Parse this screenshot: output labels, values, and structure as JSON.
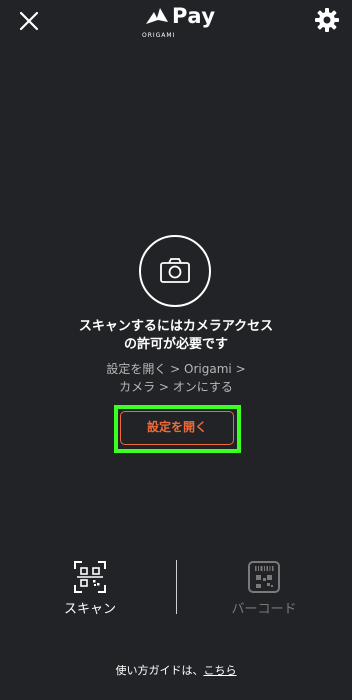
{
  "header": {
    "logo_text": "Pay",
    "logo_sub": "ORIGAMI"
  },
  "permission": {
    "title_line1": "スキャンするにはカメラアクセス",
    "title_line2": "の許可が必要です",
    "sub_line1": "設定を開く > Origami >",
    "sub_line2": "カメラ > オンにする",
    "button_label": "設定を開く"
  },
  "tabs": {
    "scan_label": "スキャン",
    "barcode_label": "バーコード"
  },
  "guide": {
    "prefix": "使い方ガイドは、",
    "link": "こちら"
  },
  "colors": {
    "background": "#222326",
    "accent": "#ef6a3a",
    "highlight": "#3cff24"
  },
  "icons": [
    "close-icon",
    "crane-logo-icon",
    "gear-icon",
    "camera-icon",
    "qr-scan-icon",
    "barcode-icon"
  ]
}
